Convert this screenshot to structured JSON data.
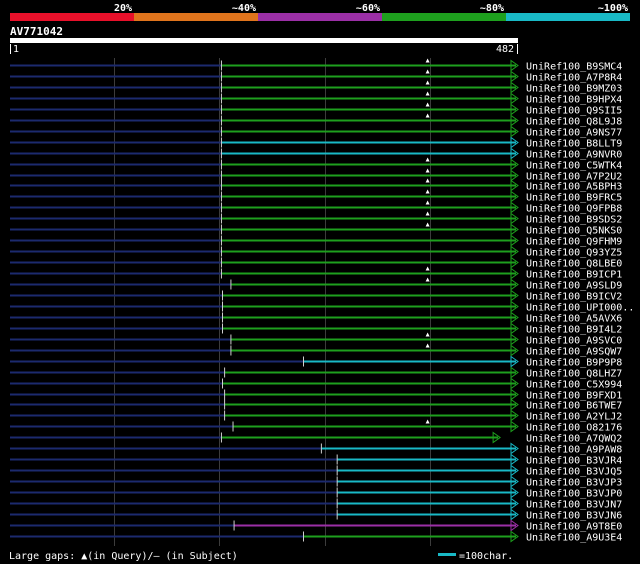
{
  "legend": {
    "ticks": [
      "20%",
      "~40%",
      "~60%",
      "~80%",
      "~100%"
    ],
    "colors": [
      "#e8102a",
      "#e0741c",
      "#9b2fa6",
      "#1ea01e",
      "#19b9c6"
    ]
  },
  "query": {
    "name": "AV771042",
    "start": "1",
    "end": "482",
    "length": 482
  },
  "hits": [
    {
      "label": "UniRef100_B9SMC4",
      "color": "#1ea01e",
      "q_start": 202,
      "q_end": 482,
      "s_start": 202,
      "s_end": 482,
      "gaps": [
        398
      ]
    },
    {
      "label": "UniRef100_A7P8R4",
      "color": "#1ea01e",
      "q_start": 202,
      "q_end": 482,
      "s_start": 202,
      "s_end": 482,
      "gaps": [
        398
      ]
    },
    {
      "label": "UniRef100_B9MZ03",
      "color": "#1ea01e",
      "q_start": 202,
      "q_end": 482,
      "s_start": 202,
      "s_end": 482,
      "gaps": [
        398
      ]
    },
    {
      "label": "UniRef100_B9HPX4",
      "color": "#1ea01e",
      "q_start": 202,
      "q_end": 482,
      "s_start": 202,
      "s_end": 482,
      "gaps": [
        398
      ]
    },
    {
      "label": "UniRef100_Q9SII5",
      "color": "#1ea01e",
      "q_start": 202,
      "q_end": 482,
      "s_start": 202,
      "s_end": 482,
      "gaps": [
        398
      ]
    },
    {
      "label": "UniRef100_Q8L9J8",
      "color": "#1ea01e",
      "q_start": 202,
      "q_end": 482,
      "s_start": 202,
      "s_end": 482,
      "gaps": [
        398
      ]
    },
    {
      "label": "UniRef100_A9NS77",
      "color": "#1ea01e",
      "q_start": 202,
      "q_end": 482,
      "s_start": 202,
      "s_end": 482,
      "gaps": []
    },
    {
      "label": "UniRef100_B8LLT9",
      "color": "#19b9c6",
      "q_start": 202,
      "q_end": 482,
      "s_start": 202,
      "s_end": 482,
      "gaps": []
    },
    {
      "label": "UniRef100_A9NVR0",
      "color": "#19b9c6",
      "q_start": 202,
      "q_end": 482,
      "s_start": 202,
      "s_end": 482,
      "gaps": []
    },
    {
      "label": "UniRef100_C5WTK4",
      "color": "#1ea01e",
      "q_start": 202,
      "q_end": 482,
      "s_start": 202,
      "s_end": 482,
      "gaps": [
        398
      ]
    },
    {
      "label": "UniRef100_A7P2U2",
      "color": "#1ea01e",
      "q_start": 202,
      "q_end": 482,
      "s_start": 202,
      "s_end": 482,
      "gaps": [
        398
      ]
    },
    {
      "label": "UniRef100_A5BPH3",
      "color": "#1ea01e",
      "q_start": 202,
      "q_end": 482,
      "s_start": 202,
      "s_end": 482,
      "gaps": [
        398
      ]
    },
    {
      "label": "UniRef100_B9FRC5",
      "color": "#1ea01e",
      "q_start": 202,
      "q_end": 482,
      "s_start": 202,
      "s_end": 482,
      "gaps": [
        398
      ]
    },
    {
      "label": "UniRef100_Q9FPB8",
      "color": "#1ea01e",
      "q_start": 202,
      "q_end": 482,
      "s_start": 202,
      "s_end": 482,
      "gaps": [
        398
      ]
    },
    {
      "label": "UniRef100_B9SDS2",
      "color": "#1ea01e",
      "q_start": 202,
      "q_end": 482,
      "s_start": 202,
      "s_end": 482,
      "gaps": [
        398
      ]
    },
    {
      "label": "UniRef100_Q5NKS0",
      "color": "#1ea01e",
      "q_start": 202,
      "q_end": 482,
      "s_start": 202,
      "s_end": 482,
      "gaps": [
        398
      ]
    },
    {
      "label": "UniRef100_Q9FHM9",
      "color": "#1ea01e",
      "q_start": 202,
      "q_end": 482,
      "s_start": 202,
      "s_end": 482,
      "gaps": []
    },
    {
      "label": "UniRef100_Q93YZ5",
      "color": "#1ea01e",
      "q_start": 202,
      "q_end": 482,
      "s_start": 202,
      "s_end": 482,
      "gaps": []
    },
    {
      "label": "UniRef100_Q8LBE0",
      "color": "#1ea01e",
      "q_start": 202,
      "q_end": 482,
      "s_start": 202,
      "s_end": 482,
      "gaps": []
    },
    {
      "label": "UniRef100_B9ICP1",
      "color": "#1ea01e",
      "q_start": 202,
      "q_end": 482,
      "s_start": 202,
      "s_end": 482,
      "gaps": [
        398
      ]
    },
    {
      "label": "UniRef100_A9SLD9",
      "color": "#1ea01e",
      "q_start": 211,
      "q_end": 482,
      "s_start": 211,
      "s_end": 482,
      "gaps": [
        398
      ]
    },
    {
      "label": "UniRef100_B9ICV2",
      "color": "#1ea01e",
      "q_start": 203,
      "q_end": 482,
      "s_start": 203,
      "s_end": 482,
      "gaps": []
    },
    {
      "label": "UniRef100_UPI000..",
      "color": "#1ea01e",
      "q_start": 203,
      "q_end": 482,
      "s_start": 203,
      "s_end": 482,
      "gaps": []
    },
    {
      "label": "UniRef100_A5AVX6",
      "color": "#1ea01e",
      "q_start": 203,
      "q_end": 482,
      "s_start": 203,
      "s_end": 482,
      "gaps": []
    },
    {
      "label": "UniRef100_B9I4L2",
      "color": "#1ea01e",
      "q_start": 203,
      "q_end": 482,
      "s_start": 203,
      "s_end": 482,
      "gaps": []
    },
    {
      "label": "UniRef100_A9SVC0",
      "color": "#1ea01e",
      "q_start": 211,
      "q_end": 482,
      "s_start": 211,
      "s_end": 482,
      "gaps": [
        398
      ]
    },
    {
      "label": "UniRef100_A9SQW7",
      "color": "#1ea01e",
      "q_start": 211,
      "q_end": 482,
      "s_start": 211,
      "s_end": 482,
      "gaps": [
        398
      ]
    },
    {
      "label": "UniRef100_B9P9P8",
      "color": "#19b9c6",
      "q_start": 280,
      "q_end": 482,
      "s_start": 280,
      "s_end": 482,
      "gaps": []
    },
    {
      "label": "UniRef100_Q8LHZ7",
      "color": "#1ea01e",
      "q_start": 205,
      "q_end": 482,
      "s_start": 205,
      "s_end": 482,
      "gaps": []
    },
    {
      "label": "UniRef100_C5X994",
      "color": "#1ea01e",
      "q_start": 203,
      "q_end": 482,
      "s_start": 203,
      "s_end": 482,
      "gaps": []
    },
    {
      "label": "UniRef100_B9FXD1",
      "color": "#1ea01e",
      "q_start": 205,
      "q_end": 482,
      "s_start": 205,
      "s_end": 482,
      "gaps": []
    },
    {
      "label": "UniRef100_B6TWE7",
      "color": "#1ea01e",
      "q_start": 205,
      "q_end": 482,
      "s_start": 205,
      "s_end": 482,
      "gaps": []
    },
    {
      "label": "UniRef100_A2YLJ2",
      "color": "#1ea01e",
      "q_start": 205,
      "q_end": 482,
      "s_start": 205,
      "s_end": 482,
      "gaps": []
    },
    {
      "label": "UniRef100_O82176",
      "color": "#1ea01e",
      "q_start": 213,
      "q_end": 482,
      "s_start": 213,
      "s_end": 482,
      "gaps": [
        398
      ]
    },
    {
      "label": "UniRef100_A7QWQ2",
      "color": "#1ea01e",
      "q_start": 202,
      "q_end": 465,
      "s_start": 202,
      "s_end": 465,
      "gaps": []
    },
    {
      "label": "UniRef100_A9PAW8",
      "color": "#19b9c6",
      "q_start": 297,
      "q_end": 482,
      "s_start": 297,
      "s_end": 482,
      "gaps": []
    },
    {
      "label": "UniRef100_B3VJR4",
      "color": "#19b9c6",
      "q_start": 312,
      "q_end": 482,
      "s_start": 312,
      "s_end": 482,
      "gaps": []
    },
    {
      "label": "UniRef100_B3VJQ5",
      "color": "#19b9c6",
      "q_start": 312,
      "q_end": 482,
      "s_start": 312,
      "s_end": 482,
      "gaps": []
    },
    {
      "label": "UniRef100_B3VJP3",
      "color": "#19b9c6",
      "q_start": 312,
      "q_end": 482,
      "s_start": 312,
      "s_end": 482,
      "gaps": []
    },
    {
      "label": "UniRef100_B3VJP0",
      "color": "#19b9c6",
      "q_start": 312,
      "q_end": 482,
      "s_start": 312,
      "s_end": 482,
      "gaps": []
    },
    {
      "label": "UniRef100_B3VJN7",
      "color": "#19b9c6",
      "q_start": 312,
      "q_end": 482,
      "s_start": 312,
      "s_end": 482,
      "gaps": []
    },
    {
      "label": "UniRef100_B3VJN6",
      "color": "#19b9c6",
      "q_start": 312,
      "q_end": 482,
      "s_start": 312,
      "s_end": 482,
      "gaps": []
    },
    {
      "label": "UniRef100_A9T8E0",
      "color": "#9b2fa6",
      "q_start": 214,
      "q_end": 482,
      "s_start": 214,
      "s_end": 482,
      "gaps": []
    },
    {
      "label": "UniRef100_A9U3E4",
      "color": "#1ea01e",
      "q_start": 280,
      "q_end": 482,
      "s_start": 280,
      "s_end": 482,
      "gaps": []
    }
  ],
  "footer": {
    "gaps_text": "Large gaps: ▲(in Query)/– (in Subject)",
    "scale_text": "=100char.",
    "scale_color": "#19b9c6"
  }
}
